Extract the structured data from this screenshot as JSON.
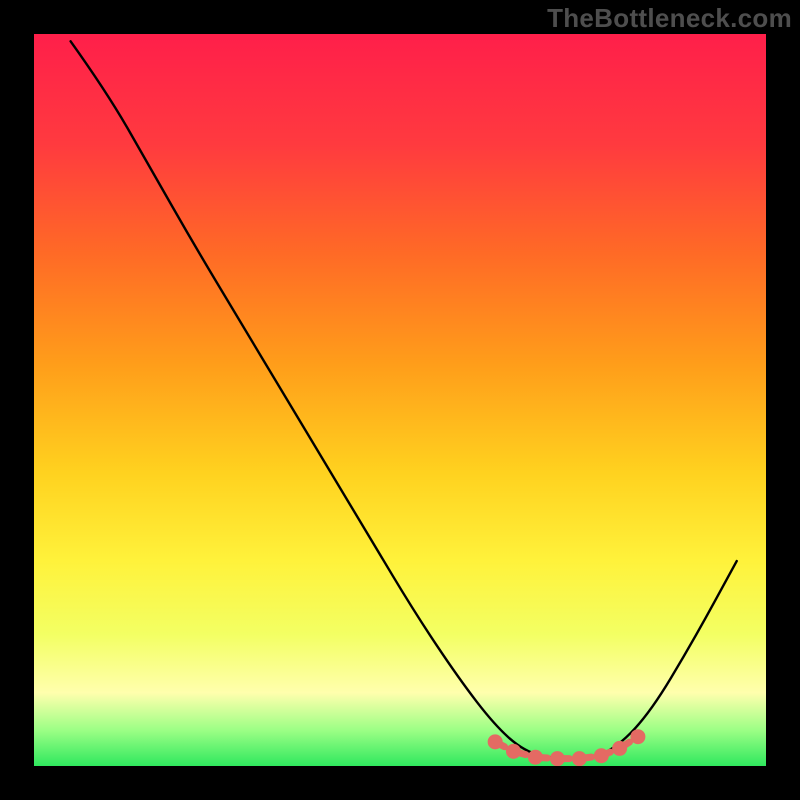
{
  "watermark_text": "TheBottleneck.com",
  "chart_data": {
    "type": "line",
    "title": "",
    "xlabel": "",
    "ylabel": "",
    "xlim": [
      0,
      100
    ],
    "ylim": [
      0,
      100
    ],
    "curve": [
      {
        "x": 5.0,
        "y": 99.0
      },
      {
        "x": 10.0,
        "y": 92.0
      },
      {
        "x": 16.0,
        "y": 81.5
      },
      {
        "x": 22.0,
        "y": 71.0
      },
      {
        "x": 28.0,
        "y": 61.0
      },
      {
        "x": 34.0,
        "y": 51.0
      },
      {
        "x": 40.0,
        "y": 41.0
      },
      {
        "x": 46.0,
        "y": 31.0
      },
      {
        "x": 52.0,
        "y": 21.0
      },
      {
        "x": 58.0,
        "y": 12.0
      },
      {
        "x": 63.0,
        "y": 5.5
      },
      {
        "x": 67.0,
        "y": 2.0
      },
      {
        "x": 71.0,
        "y": 1.0
      },
      {
        "x": 75.0,
        "y": 1.0
      },
      {
        "x": 79.0,
        "y": 2.0
      },
      {
        "x": 84.0,
        "y": 7.0
      },
      {
        "x": 90.0,
        "y": 17.0
      },
      {
        "x": 96.0,
        "y": 28.0
      }
    ],
    "marker_region_x": [
      62.0,
      82.0
    ],
    "markers": [
      {
        "x": 63.0,
        "y": 3.3
      },
      {
        "x": 65.5,
        "y": 2.0
      },
      {
        "x": 68.5,
        "y": 1.2
      },
      {
        "x": 71.5,
        "y": 1.0
      },
      {
        "x": 74.5,
        "y": 1.0
      },
      {
        "x": 77.5,
        "y": 1.4
      },
      {
        "x": 80.0,
        "y": 2.4
      },
      {
        "x": 82.5,
        "y": 4.0
      }
    ],
    "gradient_stops": [
      {
        "offset": 0.0,
        "color": "#ff1f4a"
      },
      {
        "offset": 0.15,
        "color": "#ff3a3f"
      },
      {
        "offset": 0.3,
        "color": "#ff6a26"
      },
      {
        "offset": 0.45,
        "color": "#ff9d1a"
      },
      {
        "offset": 0.6,
        "color": "#ffd21f"
      },
      {
        "offset": 0.72,
        "color": "#fff23b"
      },
      {
        "offset": 0.82,
        "color": "#f3ff63"
      },
      {
        "offset": 0.9,
        "color": "#ffffad"
      },
      {
        "offset": 0.95,
        "color": "#9eff86"
      },
      {
        "offset": 1.0,
        "color": "#2fe85e"
      }
    ]
  }
}
